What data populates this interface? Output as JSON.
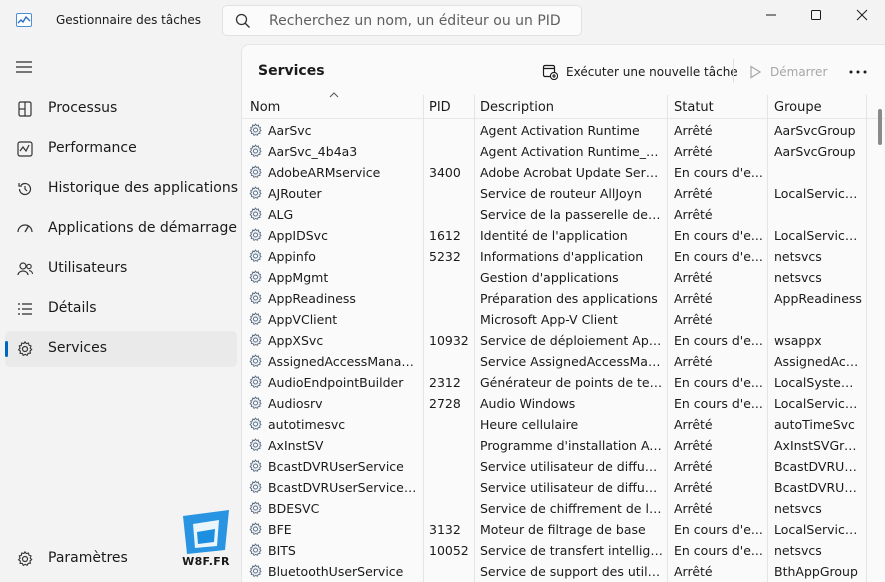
{
  "window": {
    "title": "Gestionnaire des tâches"
  },
  "search": {
    "placeholder": "Recherchez un nom, un éditeur ou un PID"
  },
  "nav": {
    "items": [
      {
        "label": "Processus",
        "icon": "processes-icon"
      },
      {
        "label": "Performance",
        "icon": "performance-icon"
      },
      {
        "label": "Historique des applications",
        "icon": "app-history-icon"
      },
      {
        "label": "Applications de démarrage",
        "icon": "startup-apps-icon"
      },
      {
        "label": "Utilisateurs",
        "icon": "users-icon"
      },
      {
        "label": "Détails",
        "icon": "details-icon"
      },
      {
        "label": "Services",
        "icon": "services-icon",
        "active": true
      }
    ],
    "settings_label": "Paramètres"
  },
  "page": {
    "title": "Services",
    "run_task_label": "Exécuter une nouvelle tâche",
    "start_label": "Démarrer"
  },
  "table": {
    "columns": [
      "Nom",
      "PID",
      "Description",
      "Statut",
      "Groupe"
    ],
    "rows": [
      [
        "AarSvc",
        "",
        "Agent Activation Runtime",
        "Arrêté",
        "AarSvcGroup"
      ],
      [
        "AarSvc_4b4a3",
        "",
        "Agent Activation Runtime_4b...",
        "Arrêté",
        "AarSvcGroup"
      ],
      [
        "AdobeARMservice",
        "3400",
        "Adobe Acrobat Update Servi...",
        "En cours d'e...",
        ""
      ],
      [
        "AJRouter",
        "",
        "Service de routeur AllJoyn",
        "Arrêté",
        "LocalService..."
      ],
      [
        "ALG",
        "",
        "Service de la passerelle de la...",
        "Arrêté",
        ""
      ],
      [
        "AppIDSvc",
        "1612",
        "Identité de l'application",
        "En cours d'e...",
        "LocalService..."
      ],
      [
        "Appinfo",
        "5232",
        "Informations d'application",
        "En cours d'e...",
        "netsvcs"
      ],
      [
        "AppMgmt",
        "",
        "Gestion d'applications",
        "Arrêté",
        "netsvcs"
      ],
      [
        "AppReadiness",
        "",
        "Préparation des applications",
        "Arrêté",
        "AppReadiness"
      ],
      [
        "AppVClient",
        "",
        "Microsoft App-V Client",
        "Arrêté",
        ""
      ],
      [
        "AppXSvc",
        "10932",
        "Service de déploiement App...",
        "En cours d'e...",
        "wsappx"
      ],
      [
        "AssignedAccessManager...",
        "",
        "Service AssignedAccessMana...",
        "Arrêté",
        "AssignedAcc..."
      ],
      [
        "AudioEndpointBuilder",
        "2312",
        "Générateur de points de ter...",
        "En cours d'e...",
        "LocalSystem..."
      ],
      [
        "Audiosrv",
        "2728",
        "Audio Windows",
        "En cours d'e...",
        "LocalService..."
      ],
      [
        "autotimesvc",
        "",
        "Heure cellulaire",
        "Arrêté",
        "autoTimeSvc"
      ],
      [
        "AxInstSV",
        "",
        "Programme d'installation Acti...",
        "Arrêté",
        "AxInstSVGroup"
      ],
      [
        "BcastDVRUserService",
        "",
        "Service utilisateur de diffusio...",
        "Arrêté",
        "BcastDVRUse..."
      ],
      [
        "BcastDVRUserService_4b...",
        "",
        "Service utilisateur de diffusio...",
        "Arrêté",
        "BcastDVRUse..."
      ],
      [
        "BDESVC",
        "",
        "Service de chiffrement de lec...",
        "Arrêté",
        "netsvcs"
      ],
      [
        "BFE",
        "3132",
        "Moteur de filtrage de base",
        "En cours d'e...",
        "LocalService..."
      ],
      [
        "BITS",
        "10052",
        "Service de transfert intelligen...",
        "En cours d'e...",
        "netsvcs"
      ],
      [
        "BluetoothUserService",
        "",
        "Service de support des utilis...",
        "Arrêté",
        "BthAppGroup"
      ]
    ]
  },
  "watermark": {
    "text": "W8F.FR"
  },
  "colors": {
    "accent": "#0067c0",
    "watermark_blue": "#1d8fe0"
  }
}
